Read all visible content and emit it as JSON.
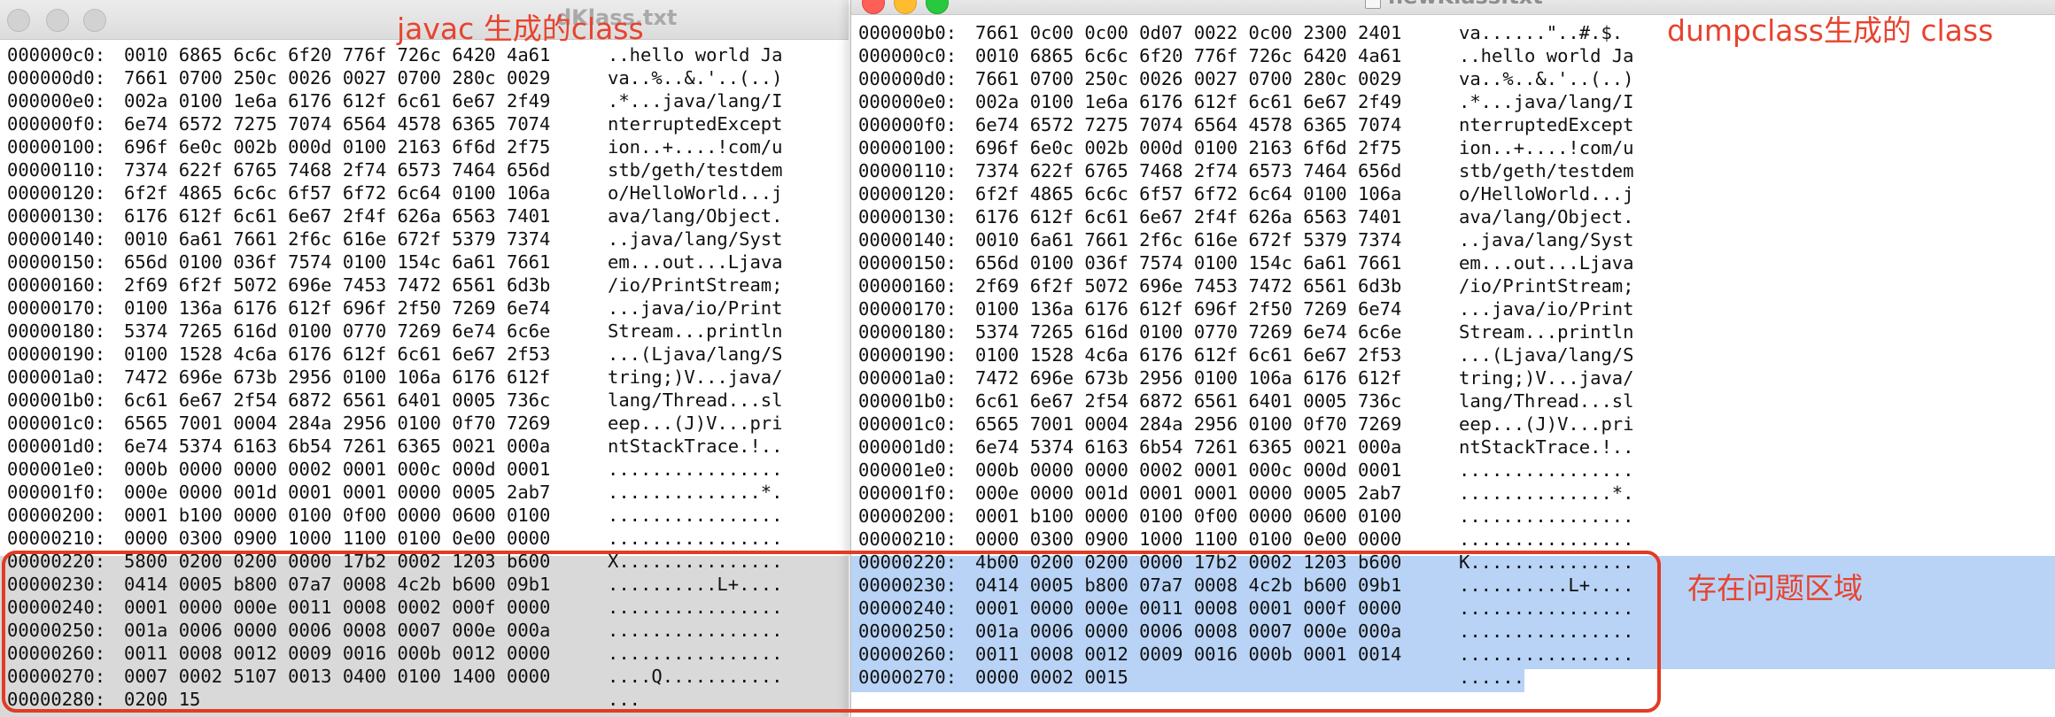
{
  "windows": {
    "left": {
      "title": "dKlass.txt",
      "annotation": "javac 生成的class",
      "lines": [
        {
          "addr": "000000c0:",
          "hex": "0010 6865 6c6c 6f20 776f 726c 6420 4a61",
          "ascii": "..hello world Ja"
        },
        {
          "addr": "000000d0:",
          "hex": "7661 0700 250c 0026 0027 0700 280c 0029",
          "ascii": "va..%..&.'..(..)"
        },
        {
          "addr": "000000e0:",
          "hex": "002a 0100 1e6a 6176 612f 6c61 6e67 2f49",
          "ascii": ".*...java/lang/I"
        },
        {
          "addr": "000000f0:",
          "hex": "6e74 6572 7275 7074 6564 4578 6365 7074",
          "ascii": "nterruptedExcept"
        },
        {
          "addr": "00000100:",
          "hex": "696f 6e0c 002b 000d 0100 2163 6f6d 2f75",
          "ascii": "ion..+....!com/u"
        },
        {
          "addr": "00000110:",
          "hex": "7374 622f 6765 7468 2f74 6573 7464 656d",
          "ascii": "stb/geth/testdem"
        },
        {
          "addr": "00000120:",
          "hex": "6f2f 4865 6c6c 6f57 6f72 6c64 0100 106a",
          "ascii": "o/HelloWorld...j"
        },
        {
          "addr": "00000130:",
          "hex": "6176 612f 6c61 6e67 2f4f 626a 6563 7401",
          "ascii": "ava/lang/Object."
        },
        {
          "addr": "00000140:",
          "hex": "0010 6a61 7661 2f6c 616e 672f 5379 7374",
          "ascii": "..java/lang/Syst"
        },
        {
          "addr": "00000150:",
          "hex": "656d 0100 036f 7574 0100 154c 6a61 7661",
          "ascii": "em...out...Ljava"
        },
        {
          "addr": "00000160:",
          "hex": "2f69 6f2f 5072 696e 7453 7472 6561 6d3b",
          "ascii": "/io/PrintStream;"
        },
        {
          "addr": "00000170:",
          "hex": "0100 136a 6176 612f 696f 2f50 7269 6e74",
          "ascii": "...java/io/Print"
        },
        {
          "addr": "00000180:",
          "hex": "5374 7265 616d 0100 0770 7269 6e74 6c6e",
          "ascii": "Stream...println"
        },
        {
          "addr": "00000190:",
          "hex": "0100 1528 4c6a 6176 612f 6c61 6e67 2f53",
          "ascii": "...(Ljava/lang/S"
        },
        {
          "addr": "000001a0:",
          "hex": "7472 696e 673b 2956 0100 106a 6176 612f",
          "ascii": "tring;)V...java/"
        },
        {
          "addr": "000001b0:",
          "hex": "6c61 6e67 2f54 6872 6561 6401 0005 736c",
          "ascii": "lang/Thread...sl"
        },
        {
          "addr": "000001c0:",
          "hex": "6565 7001 0004 284a 2956 0100 0f70 7269",
          "ascii": "eep...(J)V...pri"
        },
        {
          "addr": "000001d0:",
          "hex": "6e74 5374 6163 6b54 7261 6365 0021 000a",
          "ascii": "ntStackTrace.!.."
        },
        {
          "addr": "000001e0:",
          "hex": "000b 0000 0000 0002 0001 000c 000d 0001",
          "ascii": "................"
        },
        {
          "addr": "000001f0:",
          "hex": "000e 0000 001d 0001 0001 0000 0005 2ab7",
          "ascii": "..............*."
        },
        {
          "addr": "00000200:",
          "hex": "0001 b100 0000 0100 0f00 0000 0600 0100",
          "ascii": "................"
        },
        {
          "addr": "00000210:",
          "hex": "0000 0300 0900 1000 1100 0100 0e00 0000",
          "ascii": "................"
        },
        {
          "addr": "00000220:",
          "hex": "5800 0200 0200 0000 17b2 0002 1203 b600",
          "ascii": "X..............."
        },
        {
          "addr": "00000230:",
          "hex": "0414 0005 b800 07a7 0008 4c2b b600 09b1",
          "ascii": "..........L+...."
        },
        {
          "addr": "00000240:",
          "hex": "0001 0000 000e 0011 0008 0002 000f 0000",
          "ascii": "................"
        },
        {
          "addr": "00000250:",
          "hex": "001a 0006 0000 0006 0008 0007 000e 000a",
          "ascii": "................"
        },
        {
          "addr": "00000260:",
          "hex": "0011 0008 0012 0009 0016 000b 0012 0000",
          "ascii": "................"
        },
        {
          "addr": "00000270:",
          "hex": "0007 0002 5107 0013 0400 0100 1400 0000",
          "ascii": "....Q..........."
        },
        {
          "addr": "00000280:",
          "hex": "0200 15",
          "ascii": "..."
        }
      ]
    },
    "right": {
      "title": "newKlass.txt",
      "annotation": "dumpclass生成的 class",
      "problem_label": "存在问题区域",
      "lines": [
        {
          "addr": "000000b0:",
          "hex": "7661 0c00 0c00 0d07 0022 0c00 2300 2401",
          "ascii": "va......\"..#.$."
        },
        {
          "addr": "000000c0:",
          "hex": "0010 6865 6c6c 6f20 776f 726c 6420 4a61",
          "ascii": "..hello world Ja"
        },
        {
          "addr": "000000d0:",
          "hex": "7661 0700 250c 0026 0027 0700 280c 0029",
          "ascii": "va..%..&.'..(..)"
        },
        {
          "addr": "000000e0:",
          "hex": "002a 0100 1e6a 6176 612f 6c61 6e67 2f49",
          "ascii": ".*...java/lang/I"
        },
        {
          "addr": "000000f0:",
          "hex": "6e74 6572 7275 7074 6564 4578 6365 7074",
          "ascii": "nterruptedExcept"
        },
        {
          "addr": "00000100:",
          "hex": "696f 6e0c 002b 000d 0100 2163 6f6d 2f75",
          "ascii": "ion..+....!com/u"
        },
        {
          "addr": "00000110:",
          "hex": "7374 622f 6765 7468 2f74 6573 7464 656d",
          "ascii": "stb/geth/testdem"
        },
        {
          "addr": "00000120:",
          "hex": "6f2f 4865 6c6c 6f57 6f72 6c64 0100 106a",
          "ascii": "o/HelloWorld...j"
        },
        {
          "addr": "00000130:",
          "hex": "6176 612f 6c61 6e67 2f4f 626a 6563 7401",
          "ascii": "ava/lang/Object."
        },
        {
          "addr": "00000140:",
          "hex": "0010 6a61 7661 2f6c 616e 672f 5379 7374",
          "ascii": "..java/lang/Syst"
        },
        {
          "addr": "00000150:",
          "hex": "656d 0100 036f 7574 0100 154c 6a61 7661",
          "ascii": "em...out...Ljava"
        },
        {
          "addr": "00000160:",
          "hex": "2f69 6f2f 5072 696e 7453 7472 6561 6d3b",
          "ascii": "/io/PrintStream;"
        },
        {
          "addr": "00000170:",
          "hex": "0100 136a 6176 612f 696f 2f50 7269 6e74",
          "ascii": "...java/io/Print"
        },
        {
          "addr": "00000180:",
          "hex": "5374 7265 616d 0100 0770 7269 6e74 6c6e",
          "ascii": "Stream...println"
        },
        {
          "addr": "00000190:",
          "hex": "0100 1528 4c6a 6176 612f 6c61 6e67 2f53",
          "ascii": "...(Ljava/lang/S"
        },
        {
          "addr": "000001a0:",
          "hex": "7472 696e 673b 2956 0100 106a 6176 612f",
          "ascii": "tring;)V...java/"
        },
        {
          "addr": "000001b0:",
          "hex": "6c61 6e67 2f54 6872 6561 6401 0005 736c",
          "ascii": "lang/Thread...sl"
        },
        {
          "addr": "000001c0:",
          "hex": "6565 7001 0004 284a 2956 0100 0f70 7269",
          "ascii": "eep...(J)V...pri"
        },
        {
          "addr": "000001d0:",
          "hex": "6e74 5374 6163 6b54 7261 6365 0021 000a",
          "ascii": "ntStackTrace.!.."
        },
        {
          "addr": "000001e0:",
          "hex": "000b 0000 0000 0002 0001 000c 000d 0001",
          "ascii": "................"
        },
        {
          "addr": "000001f0:",
          "hex": "000e 0000 001d 0001 0001 0000 0005 2ab7",
          "ascii": "..............*."
        },
        {
          "addr": "00000200:",
          "hex": "0001 b100 0000 0100 0f00 0000 0600 0100",
          "ascii": "................"
        },
        {
          "addr": "00000210:",
          "hex": "0000 0300 0900 1000 1100 0100 0e00 0000",
          "ascii": "................"
        },
        {
          "addr": "00000220:",
          "hex": "4b00 0200 0200 0000 17b2 0002 1203 b600",
          "ascii": "K..............."
        },
        {
          "addr": "00000230:",
          "hex": "0414 0005 b800 07a7 0008 4c2b b600 09b1",
          "ascii": "..........L+...."
        },
        {
          "addr": "00000240:",
          "hex": "0001 0000 000e 0011 0008 0001 000f 0000",
          "ascii": "................"
        },
        {
          "addr": "00000250:",
          "hex": "001a 0006 0000 0006 0008 0007 000e 000a",
          "ascii": "................"
        },
        {
          "addr": "00000260:",
          "hex": "0011 0008 0012 0009 0016 000b 0001 0014",
          "ascii": "................"
        },
        {
          "addr": "00000270:",
          "hex": "0000 0002 0015",
          "ascii": "......"
        }
      ]
    }
  },
  "colors": {
    "annotation_red": "#e8432e",
    "left_selection": "#d9d9d9",
    "right_selection": "#b8d3f5",
    "box_border": "#e23b25"
  }
}
